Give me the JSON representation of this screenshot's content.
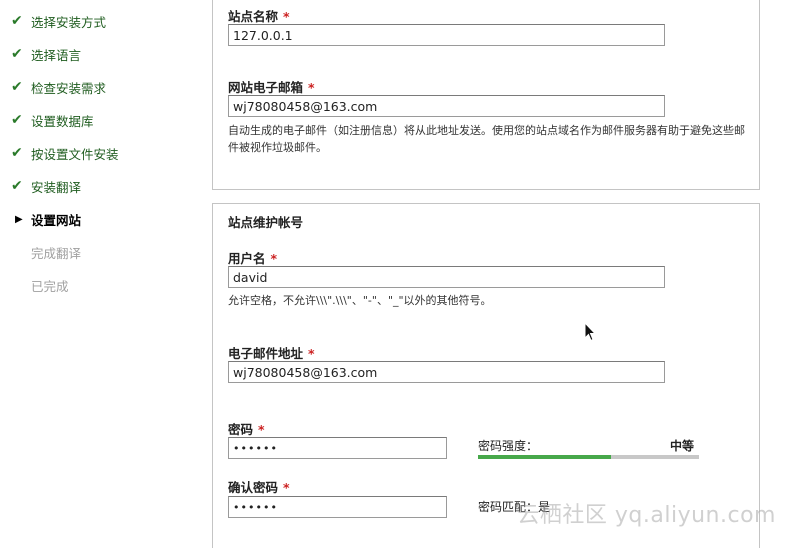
{
  "sidebar": {
    "steps": [
      {
        "label": "选择安装方式",
        "state": "done"
      },
      {
        "label": "选择语言",
        "state": "done"
      },
      {
        "label": "检查安装需求",
        "state": "done"
      },
      {
        "label": "设置数据库",
        "state": "done"
      },
      {
        "label": "按设置文件安装",
        "state": "done"
      },
      {
        "label": "安装翻译",
        "state": "done"
      },
      {
        "label": "设置网站",
        "state": "current"
      },
      {
        "label": "完成翻译",
        "state": "pending"
      },
      {
        "label": "已完成",
        "state": "pending"
      }
    ],
    "check_glyph": "✔",
    "current_glyph": "▶"
  },
  "site_info": {
    "site_name_label": "站点名称",
    "site_name_value": "127.0.0.1",
    "site_email_label": "网站电子邮箱",
    "site_email_value": "wj78080458@163.com",
    "site_email_desc": "自动生成的电子邮件（如注册信息）将从此地址发送。使用您的站点域名作为邮件服务器有助于避免这些邮件被视作垃圾邮件。"
  },
  "maintenance": {
    "legend": "站点维护帐号",
    "username_label": "用户名",
    "username_value": "david",
    "username_desc": "允许空格，不允许\\\\\\\".\\\\\\\"、\"-\"、\"_\"以外的其他符号。",
    "email_label": "电子邮件地址",
    "email_value": "wj78080458@163.com",
    "password_label": "密码",
    "password_value": "••••••",
    "confirm_label": "确认密码",
    "confirm_value": "••••••",
    "strength_label": "密码强度：",
    "strength_value": "中等",
    "strength_level": 0.6,
    "match_text": "密码匹配：是"
  },
  "required_mark": "*",
  "watermark": "云栖社区 yq.aliyun.com",
  "colors": {
    "done_text": "#1f5c1f",
    "check": "#2a7a2a",
    "pending_text": "#a0a0a0",
    "required": "#cc2222",
    "strength_fill": "#47a84a"
  }
}
